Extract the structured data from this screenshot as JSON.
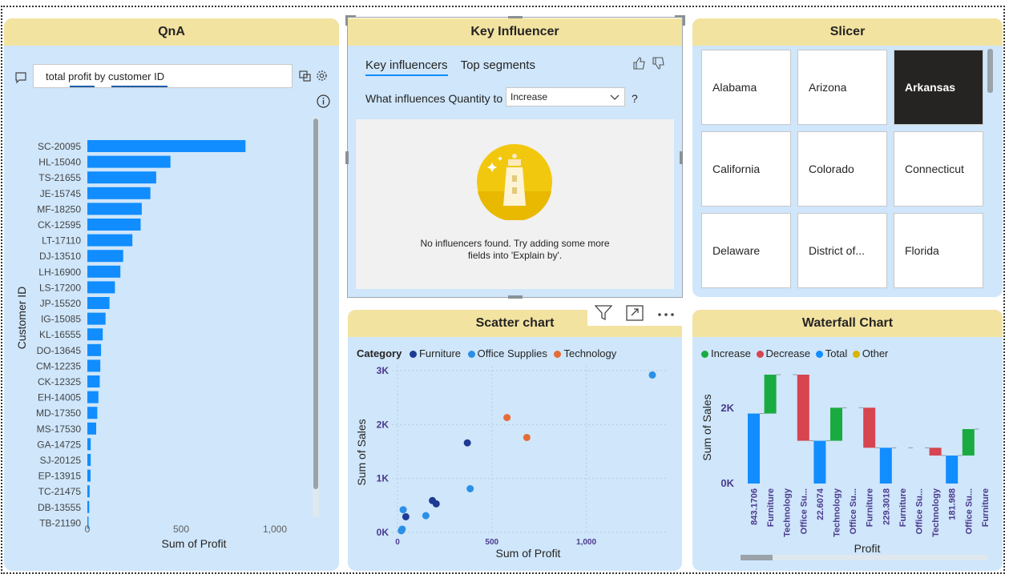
{
  "qna": {
    "title": "QnA",
    "query": "total profit by customer ID",
    "chart": {
      "ylabel": "Customer ID",
      "xlabel": "Sum of Profit",
      "ticks": [
        "0",
        "500",
        "1,000"
      ]
    }
  },
  "key_influencer": {
    "title": "Key Influencer",
    "tabs": [
      "Key influencers",
      "Top segments"
    ],
    "question_prefix": "What influences Quantity to",
    "dropdown_value": "Increase",
    "question_mark": "?",
    "empty_message_line1": "No influencers found. Try adding some more",
    "empty_message_line2": "fields into 'Explain by'."
  },
  "slicer": {
    "title": "Slicer",
    "items": [
      "Alabama",
      "Arizona",
      "Arkansas",
      "California",
      "Colorado",
      "Connecticut",
      "Delaware",
      "District of...",
      "Florida"
    ],
    "selected": "Arkansas"
  },
  "scatter": {
    "title": "Scatter chart",
    "legend_title": "Category",
    "legend": [
      "Furniture",
      "Office Supplies",
      "Technology"
    ],
    "colors": {
      "Furniture": "#1f3a93",
      "Office Supplies": "#2b8fe8",
      "Technology": "#e66c37"
    },
    "ylabel": "Sum of Sales",
    "xlabel": "Sum of Profit",
    "yticks": [
      "3K",
      "2K",
      "1K",
      "0K"
    ],
    "xticks": [
      "0",
      "500",
      "1,000"
    ]
  },
  "waterfall": {
    "title": "Waterfall Chart",
    "legend": [
      "Increase",
      "Decrease",
      "Total",
      "Other"
    ],
    "colors": {
      "Increase": "#1aab40",
      "Decrease": "#d64550",
      "Total": "#118dff",
      "Other": "#d9b300"
    },
    "ylabel": "Sum of Sales",
    "xlabel": "Profit",
    "yticks": [
      "2K",
      "0K"
    ],
    "categories": [
      "843.1706",
      "Furniture",
      "Technology",
      "Office Su...",
      "22.6074",
      "Technology",
      "Office Su...",
      "Furniture",
      "229.3018",
      "Furniture",
      "Office Su...",
      "Technology",
      "181.988",
      "Office Su...",
      "Furniture"
    ]
  },
  "chart_data": [
    {
      "type": "bar",
      "orientation": "horizontal",
      "categories": [
        "SC-20095",
        "HL-15040",
        "TS-21655",
        "JE-15745",
        "MF-18250",
        "CK-12595",
        "LT-17110",
        "DJ-13510",
        "LH-16900",
        "LS-17200",
        "JP-15520",
        "IG-15085",
        "KL-16555",
        "DO-13645",
        "CM-12235",
        "CK-12325",
        "EH-14005",
        "MD-17350",
        "MS-17530",
        "GA-14725",
        "SJ-20125",
        "EP-13915",
        "TC-21475",
        "DB-13555",
        "TB-21190"
      ],
      "values": [
        843,
        443,
        367,
        336,
        290,
        284,
        240,
        191,
        176,
        147,
        118,
        97,
        82,
        73,
        69,
        66,
        59,
        53,
        47,
        18,
        18,
        17,
        12,
        10,
        4
      ],
      "xlabel": "Sum of Profit",
      "ylabel": "Customer ID",
      "xlim": [
        0,
        1060
      ],
      "color": "#118dff"
    },
    {
      "type": "scatter",
      "series": [
        {
          "name": "Furniture",
          "points": [
            [
              44,
              290
            ],
            [
              185,
              590
            ],
            [
              205,
              530
            ],
            [
              370,
              1660
            ]
          ]
        },
        {
          "name": "Office Supplies",
          "points": [
            [
              25,
              60
            ],
            [
              30,
              420
            ],
            [
              20,
              30
            ],
            [
              150,
              310
            ],
            [
              385,
              810
            ],
            [
              1350,
              2920
            ]
          ]
        },
        {
          "name": "Technology",
          "points": [
            [
              580,
              2130
            ],
            [
              685,
              1760
            ]
          ]
        }
      ],
      "xlabel": "Sum of Profit",
      "ylabel": "Sum of Sales",
      "xlim": [
        -20,
        1400
      ],
      "ylim": [
        0,
        3000
      ]
    },
    {
      "type": "bar",
      "subtype": "waterfall",
      "categories": [
        "843.1706",
        "Furniture",
        "Technology",
        "Office Su...",
        "22.6074",
        "Technology",
        "Office Su...",
        "Furniture",
        "229.3018",
        "Furniture",
        "Office Su...",
        "Technology",
        "181.988",
        "Office Su...",
        "Furniture"
      ],
      "bars": [
        {
          "kind": "Total",
          "start": 0,
          "end": 1800
        },
        {
          "kind": "Increase",
          "start": 1800,
          "end": 2800
        },
        {
          "kind": "Increase",
          "start": 2800,
          "end": 2800
        },
        {
          "kind": "Decrease",
          "start": 2800,
          "end": 1100
        },
        {
          "kind": "Total",
          "start": 0,
          "end": 1100
        },
        {
          "kind": "Increase",
          "start": 1100,
          "end": 1950
        },
        {
          "kind": "Increase",
          "start": 1950,
          "end": 1950
        },
        {
          "kind": "Decrease",
          "start": 1950,
          "end": 920
        },
        {
          "kind": "Total",
          "start": 0,
          "end": 920
        },
        {
          "kind": "Decrease",
          "start": 920,
          "end": 920
        },
        {
          "kind": "Decrease",
          "start": 920,
          "end": 920
        },
        {
          "kind": "Decrease",
          "start": 920,
          "end": 720
        },
        {
          "kind": "Total",
          "start": 0,
          "end": 720
        },
        {
          "kind": "Increase",
          "start": 720,
          "end": 1400
        },
        {
          "kind": "Increase",
          "start": 1400,
          "end": 1400
        }
      ],
      "ylim": [
        0,
        2900
      ],
      "xlabel": "Profit",
      "ylabel": "Sum of Sales"
    }
  ]
}
